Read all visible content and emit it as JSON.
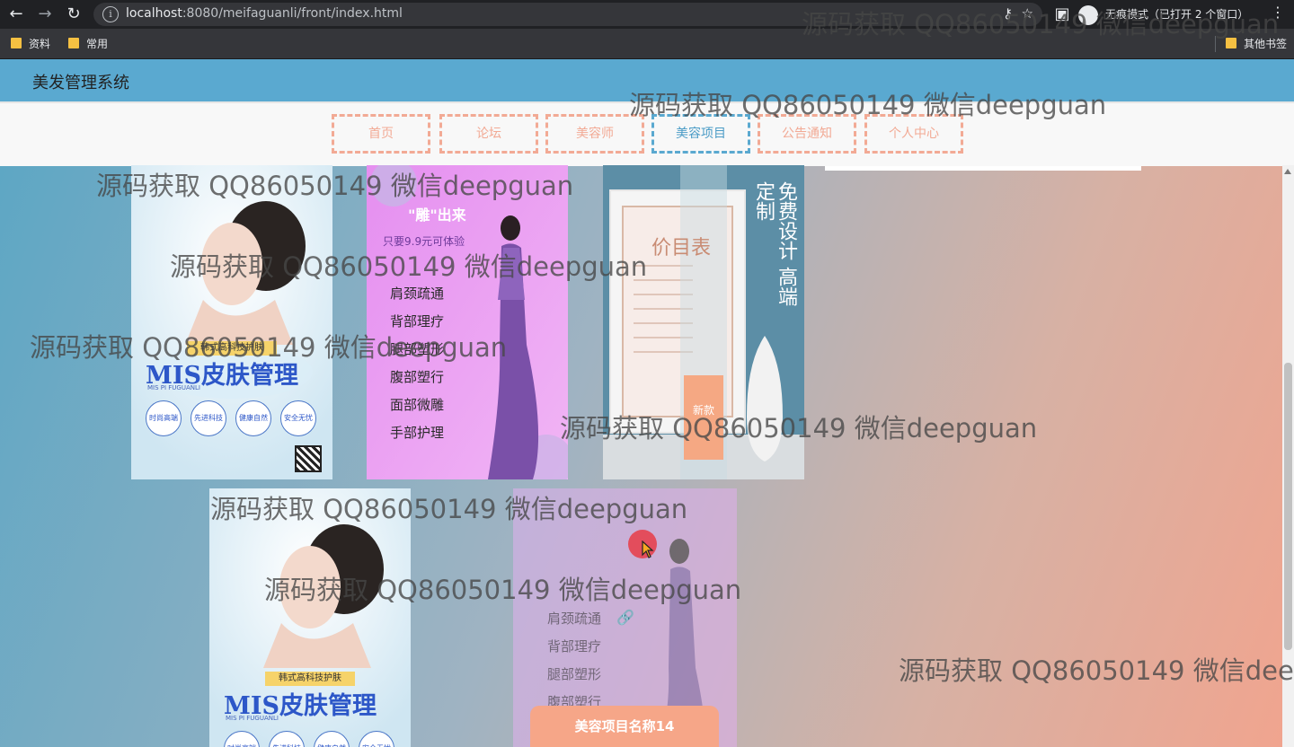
{
  "browser": {
    "url_host": "localhost",
    "url_rest": ":8080/meifaguanli/front/index.html",
    "incognito_label": "无痕模式（已打开 2 个窗口）",
    "bookmarks": [
      "资料",
      "常用"
    ],
    "other_bookmarks": "其他书签"
  },
  "app": {
    "title": "美发管理系统",
    "nav": [
      "首页",
      "论坛",
      "美容师",
      "美容项目",
      "公告通知",
      "个人中心"
    ],
    "active_nav": "美容项目"
  },
  "posters": {
    "mis": {
      "small_tag": "韩式高科技护肤",
      "title": "MIS皮肤管理",
      "subtitle": "MIS PI FUGUANLI",
      "badges": [
        "时尚高端",
        "先进科技",
        "健康自然",
        "安全无忧"
      ]
    },
    "purple": {
      "headline": "\"雕\"出来",
      "price": "只要9.9元可体验",
      "services": [
        "肩颈疏通",
        "背部理疗",
        "腿部塑形",
        "腹部塑行",
        "面部微雕",
        "手部护理"
      ]
    },
    "pricelist": {
      "title": "价目表",
      "vertical_text": "免费设计 高端定制",
      "tag": "新款"
    }
  },
  "second_row": {
    "services": [
      "肩颈疏通",
      "背部理疗",
      "腿部塑形",
      "腹部塑行"
    ],
    "item_name": "美容项目名称14"
  },
  "watermark": "源码获取 QQ86050149 微信deepguan"
}
